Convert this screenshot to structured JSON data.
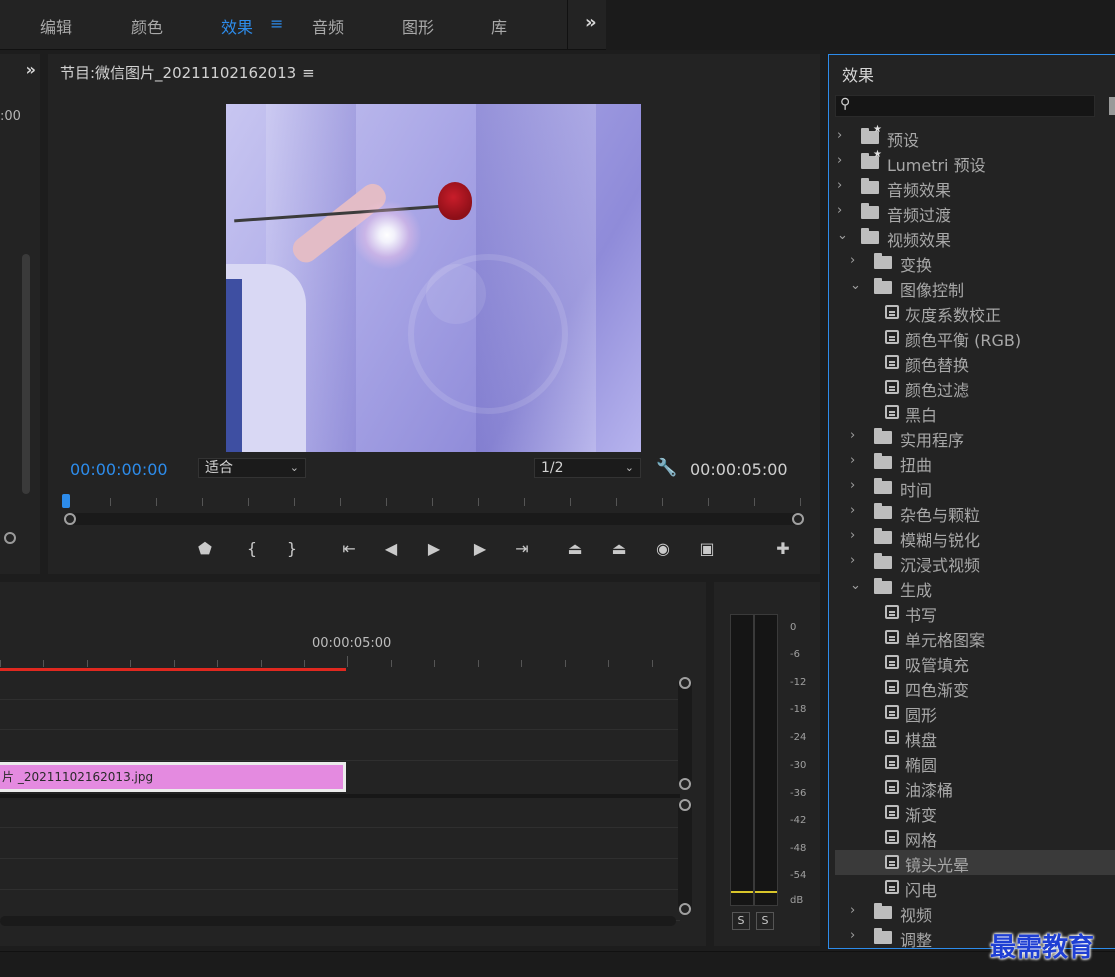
{
  "workspace": {
    "tabs": [
      "编辑",
      "颜色",
      "效果",
      "音频",
      "图形",
      "库"
    ],
    "active": "效果",
    "menu_icon": "hamburger-icon",
    "more_icon": "chevron-double-right-icon"
  },
  "left_panel": {
    "timecode": ":00"
  },
  "monitor": {
    "title": "节目:微信图片_20211102162013",
    "current_timecode": "00:00:00:00",
    "zoom_value": "适合",
    "resolution_value": "1/2",
    "total_timecode": "00:00:05:00",
    "accent_color": "#2d8ceb"
  },
  "timeline": {
    "ruler_timecode": "00:00:05:00",
    "clip_label": "片 _20211102162013.jpg",
    "clip_color": "#e48ae0"
  },
  "audio_meter": {
    "scale": [
      "0",
      "-6",
      "-12",
      "-18",
      "-24",
      "-30",
      "-36",
      "-42",
      "-48",
      "-54",
      "dB"
    ],
    "solo_labels": [
      "S",
      "S"
    ]
  },
  "effects_panel": {
    "title": "效果",
    "search_placeholder": "",
    "items": [
      {
        "label": "预设",
        "level": 0,
        "expanded": false,
        "kind": "preset-folder"
      },
      {
        "label": "Lumetri 预设",
        "level": 0,
        "expanded": false,
        "kind": "preset-folder"
      },
      {
        "label": "音频效果",
        "level": 0,
        "expanded": false,
        "kind": "folder"
      },
      {
        "label": "音频过渡",
        "level": 0,
        "expanded": false,
        "kind": "folder"
      },
      {
        "label": "视频效果",
        "level": 0,
        "expanded": true,
        "kind": "folder"
      },
      {
        "label": "变换",
        "level": 1,
        "expanded": false,
        "kind": "folder"
      },
      {
        "label": "图像控制",
        "level": 1,
        "expanded": true,
        "kind": "folder"
      },
      {
        "label": "灰度系数校正",
        "level": 2,
        "kind": "effect"
      },
      {
        "label": "颜色平衡 (RGB)",
        "level": 2,
        "kind": "effect"
      },
      {
        "label": "颜色替换",
        "level": 2,
        "kind": "effect"
      },
      {
        "label": "颜色过滤",
        "level": 2,
        "kind": "effect"
      },
      {
        "label": "黑白",
        "level": 2,
        "kind": "effect"
      },
      {
        "label": "实用程序",
        "level": 1,
        "expanded": false,
        "kind": "folder"
      },
      {
        "label": "扭曲",
        "level": 1,
        "expanded": false,
        "kind": "folder"
      },
      {
        "label": "时间",
        "level": 1,
        "expanded": false,
        "kind": "folder"
      },
      {
        "label": "杂色与颗粒",
        "level": 1,
        "expanded": false,
        "kind": "folder"
      },
      {
        "label": "模糊与锐化",
        "level": 1,
        "expanded": false,
        "kind": "folder"
      },
      {
        "label": "沉浸式视频",
        "level": 1,
        "expanded": false,
        "kind": "folder"
      },
      {
        "label": "生成",
        "level": 1,
        "expanded": true,
        "kind": "folder"
      },
      {
        "label": "书写",
        "level": 2,
        "kind": "effect"
      },
      {
        "label": "单元格图案",
        "level": 2,
        "kind": "effect"
      },
      {
        "label": "吸管填充",
        "level": 2,
        "kind": "effect"
      },
      {
        "label": "四色渐变",
        "level": 2,
        "kind": "effect"
      },
      {
        "label": "圆形",
        "level": 2,
        "kind": "effect"
      },
      {
        "label": "棋盘",
        "level": 2,
        "kind": "effect"
      },
      {
        "label": "椭圆",
        "level": 2,
        "kind": "effect"
      },
      {
        "label": "油漆桶",
        "level": 2,
        "kind": "effect"
      },
      {
        "label": "渐变",
        "level": 2,
        "kind": "effect"
      },
      {
        "label": "网格",
        "level": 2,
        "kind": "effect"
      },
      {
        "label": "镜头光晕",
        "level": 2,
        "kind": "effect",
        "selected": true
      },
      {
        "label": "闪电",
        "level": 2,
        "kind": "effect"
      },
      {
        "label": "视频",
        "level": 1,
        "expanded": false,
        "kind": "folder"
      },
      {
        "label": "调整",
        "level": 1,
        "expanded": false,
        "kind": "folder"
      }
    ]
  },
  "watermark": "最需教育"
}
